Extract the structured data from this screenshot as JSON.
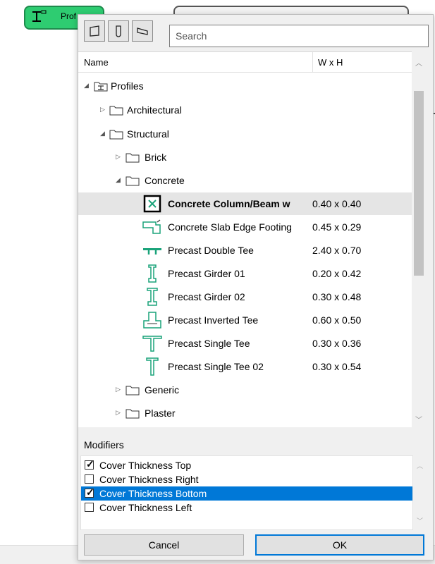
{
  "background": {
    "tab_label": "Prof"
  },
  "search": {
    "placeholder": "Search"
  },
  "list": {
    "columns": {
      "name": "Name",
      "size": "W x H"
    },
    "rows": [
      {
        "label": "Profiles",
        "size": "",
        "kind": "root",
        "expanded": true
      },
      {
        "label": "Architectural",
        "size": "",
        "kind": "folder",
        "expanded": false
      },
      {
        "label": "Structural",
        "size": "",
        "kind": "folder",
        "expanded": true
      },
      {
        "label": "Brick",
        "size": "",
        "kind": "folder",
        "expanded": false
      },
      {
        "label": "Concrete",
        "size": "",
        "kind": "folder",
        "expanded": true
      },
      {
        "label": "Concrete Column/Beam w",
        "size": "0.40 x 0.40",
        "kind": "profile",
        "selected": true,
        "icon": "column-beam-profile-icon"
      },
      {
        "label": "Concrete Slab Edge Footing",
        "size": "0.45 x 0.29",
        "kind": "profile",
        "icon": "slab-edge-footing-icon"
      },
      {
        "label": "Precast Double Tee",
        "size": "2.40 x 0.70",
        "kind": "profile",
        "icon": "double-tee-icon"
      },
      {
        "label": "Precast Girder 01",
        "size": "0.20 x 0.42",
        "kind": "profile",
        "icon": "girder-icon"
      },
      {
        "label": "Precast Girder 02",
        "size": "0.30 x 0.48",
        "kind": "profile",
        "icon": "girder-icon"
      },
      {
        "label": "Precast Inverted Tee",
        "size": "0.60 x 0.50",
        "kind": "profile",
        "icon": "inverted-tee-icon"
      },
      {
        "label": "Precast Single Tee",
        "size": "0.30 x 0.36",
        "kind": "profile",
        "icon": "single-tee-icon"
      },
      {
        "label": "Precast Single Tee 02",
        "size": "0.30 x 0.54",
        "kind": "profile",
        "icon": "single-tee-icon"
      },
      {
        "label": "Generic",
        "size": "",
        "kind": "folder",
        "expanded": false
      },
      {
        "label": "Plaster",
        "size": "",
        "kind": "folder",
        "expanded": false
      }
    ]
  },
  "modifiers": {
    "title": "Modifiers",
    "items": [
      {
        "label": "Cover Thickness Top",
        "checked": true,
        "selected": false
      },
      {
        "label": "Cover Thickness Right",
        "checked": false,
        "selected": false
      },
      {
        "label": "Cover Thickness Bottom",
        "checked": true,
        "selected": true
      },
      {
        "label": "Cover Thickness Left",
        "checked": false,
        "selected": false
      }
    ]
  },
  "buttons": {
    "cancel": "Cancel",
    "ok": "OK"
  },
  "colors": {
    "accent": "#0078d7",
    "profile_icon": "#1aa37a",
    "tab_green": "#2ecc71"
  }
}
